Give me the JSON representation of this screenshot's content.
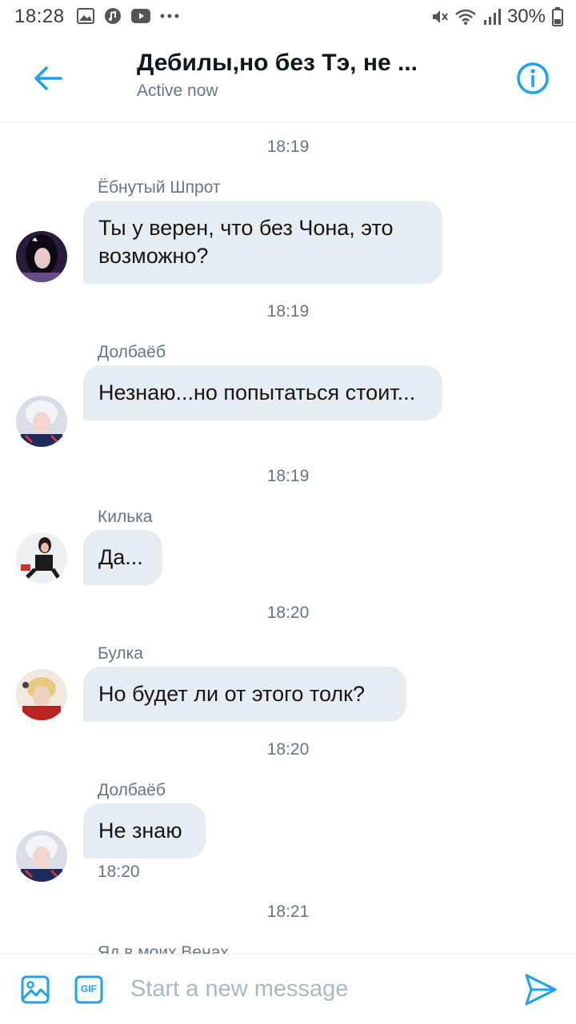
{
  "status_bar": {
    "time": "18:28",
    "battery": "30%",
    "left_icons": [
      "gallery-icon",
      "music-icon",
      "youtube-icon",
      "more-icon"
    ],
    "right_icons": [
      "mute-icon",
      "wifi-icon",
      "signal-icon",
      "battery-icon"
    ]
  },
  "header": {
    "title": "Дебилы,но без Тэ, не ...",
    "subtitle": "Active now",
    "accent_color": "#1da1f2"
  },
  "messages": [
    {
      "timestamp": "18:19",
      "sender": "Ёбнутый Шпрот",
      "text": "Ты у верен, что без Чона, это возможно?",
      "avatar": "avatar-dark-hair"
    },
    {
      "timestamp": "18:19",
      "sender": "Долбаёб",
      "text": "Незнаю...но попытаться стоит...",
      "avatar": "avatar-white-hair"
    },
    {
      "timestamp": "18:19",
      "sender": "Килька",
      "text": "Да...",
      "avatar": "avatar-sitting-girl"
    },
    {
      "timestamp": "18:20",
      "sender": "Булка",
      "text": "Но будет ли от этого толк?",
      "avatar": "avatar-blond"
    },
    {
      "timestamp": "18:20",
      "sender": "Долбаёб",
      "text": "Не знаю",
      "avatar": "avatar-white-hair",
      "time_under": "18:20"
    },
    {
      "timestamp": "18:21",
      "sender": "Яд в моих Венах"
    }
  ],
  "composer": {
    "placeholder": "Start a new message",
    "gif_label": "GIF"
  }
}
